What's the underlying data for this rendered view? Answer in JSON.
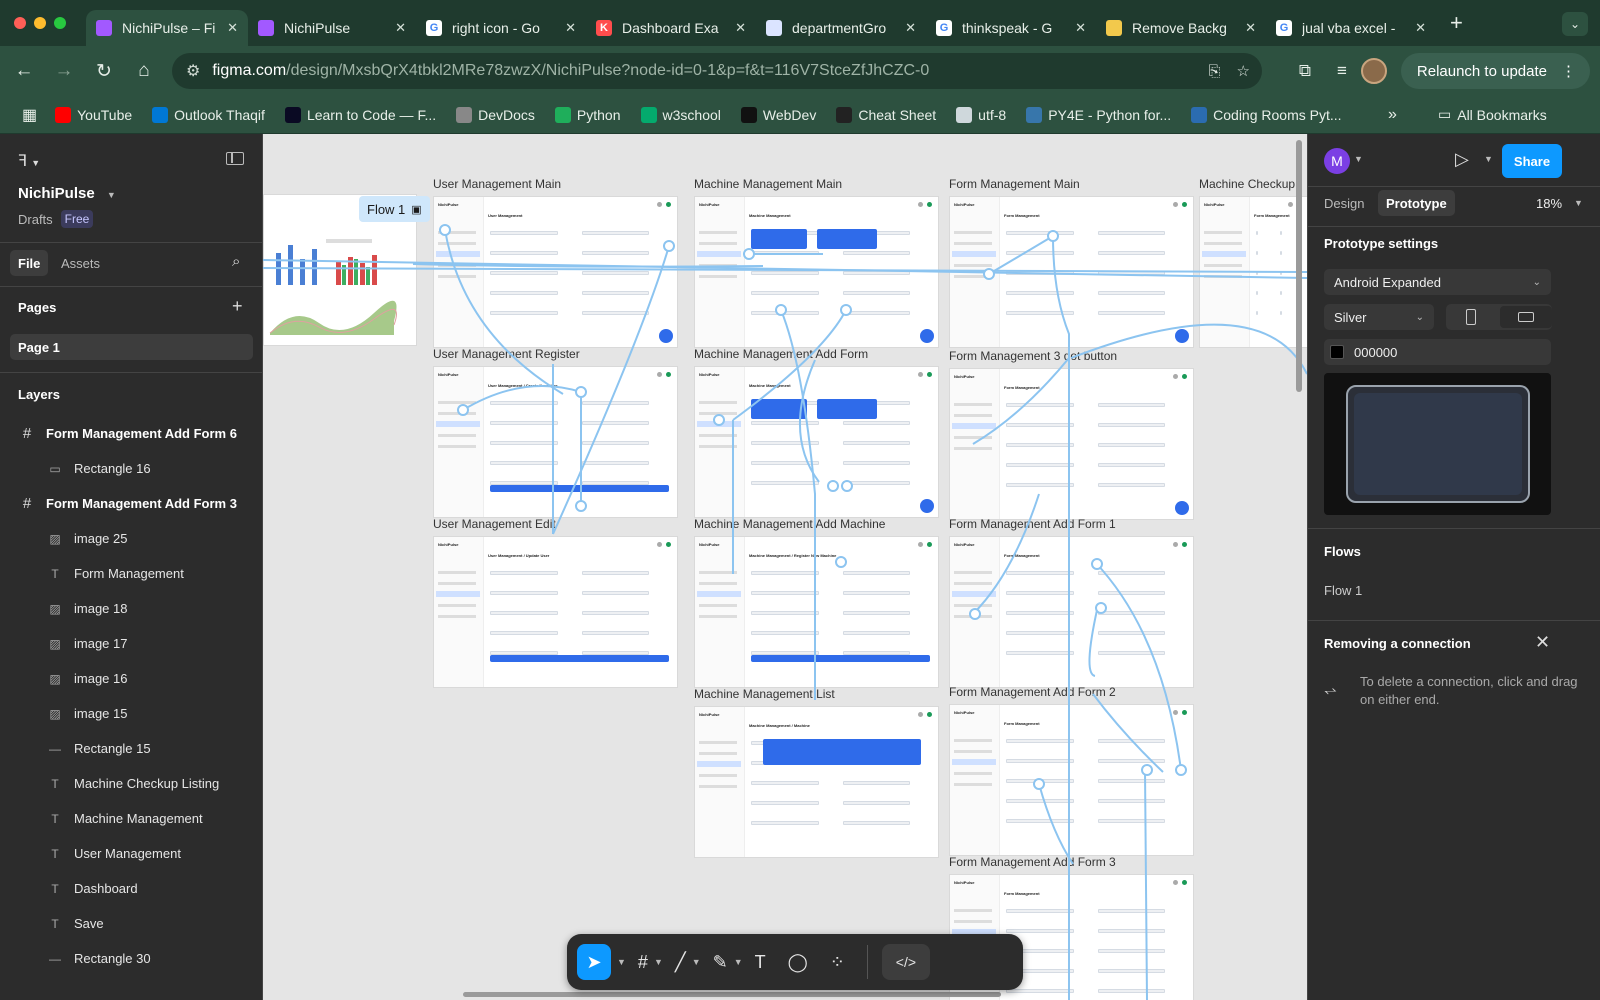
{
  "browser": {
    "tabs": [
      {
        "title": "NichiPulse – Fi",
        "favicon": "figma",
        "active": true
      },
      {
        "title": "NichiPulse",
        "favicon": "figma",
        "active": false
      },
      {
        "title": "right icon - Go",
        "favicon": "google",
        "active": false
      },
      {
        "title": "Dashboard Exa",
        "favicon": "k",
        "active": false
      },
      {
        "title": "departmentGro",
        "favicon": "doc",
        "active": false
      },
      {
        "title": "thinkspeak - G",
        "favicon": "google",
        "active": false
      },
      {
        "title": "Remove Backg",
        "favicon": "removebg",
        "active": false
      },
      {
        "title": "jual vba excel -",
        "favicon": "google",
        "active": false
      }
    ],
    "url_domain": "figma.com",
    "url_path": "/design/MxsbQrX4tbkl2MRe78zwzX/NichiPulse?node-id=0-1&p=f&t=116V7StceZfJhCZC-0",
    "relaunch_label": "Relaunch to update",
    "bookmarks": [
      {
        "label": "YouTube",
        "color": "#ff0000"
      },
      {
        "label": "Outlook Thaqif",
        "color": "#0078d4"
      },
      {
        "label": "Learn to Code — F...",
        "color": "#0a0a23"
      },
      {
        "label": "DevDocs",
        "color": "#888888"
      },
      {
        "label": "Python",
        "color": "#1fae5b"
      },
      {
        "label": "w3school",
        "color": "#04aa6d"
      },
      {
        "label": "WebDev",
        "color": "#111111"
      },
      {
        "label": "Cheat Sheet",
        "color": "#222222"
      },
      {
        "label": "utf-8",
        "color": "#cfd8dc"
      },
      {
        "label": "PY4E - Python for...",
        "color": "#3776ab"
      },
      {
        "label": "Coding Rooms Pyt...",
        "color": "#2b6cb0"
      }
    ],
    "all_bookmarks_label": "All Bookmarks"
  },
  "left_panel": {
    "project_name": "NichiPulse",
    "drafts_label": "Drafts",
    "plan_badge": "Free",
    "file_tab": "File",
    "assets_tab": "Assets",
    "pages_title": "Pages",
    "current_page": "Page 1",
    "layers_title": "Layers",
    "layers": [
      {
        "name": "Form Management Add Form 6",
        "type": "frame",
        "indent": false
      },
      {
        "name": "Rectangle 16",
        "type": "rect",
        "indent": true
      },
      {
        "name": "Form Management Add Form 3",
        "type": "frame",
        "indent": false
      },
      {
        "name": "image 25",
        "type": "image",
        "indent": true
      },
      {
        "name": "Form Management",
        "type": "text",
        "indent": true
      },
      {
        "name": "image 18",
        "type": "image",
        "indent": true
      },
      {
        "name": "image 17",
        "type": "image",
        "indent": true
      },
      {
        "name": "image 16",
        "type": "image",
        "indent": true
      },
      {
        "name": "image 15",
        "type": "image",
        "indent": true
      },
      {
        "name": "Rectangle 15",
        "type": "line",
        "indent": true
      },
      {
        "name": "Machine Checkup Listing",
        "type": "text",
        "indent": true
      },
      {
        "name": "Machine Management",
        "type": "text",
        "indent": true
      },
      {
        "name": "User Management",
        "type": "text",
        "indent": true
      },
      {
        "name": "Dashboard",
        "type": "text",
        "indent": true
      },
      {
        "name": "Save",
        "type": "text",
        "indent": true
      },
      {
        "name": "Rectangle 30",
        "type": "line",
        "indent": true
      }
    ]
  },
  "canvas": {
    "flow_badge": "Flow 1",
    "frames": [
      {
        "label": "User Management Main",
        "header": "User Management"
      },
      {
        "label": "Machine Management Main",
        "header": "Machine Management"
      },
      {
        "label": "Form Management Main",
        "header": "Form Management"
      },
      {
        "label": "Machine Checkup l",
        "header": "Form Management"
      },
      {
        "label": "User Management Register",
        "header": "User Management / Create New User"
      },
      {
        "label": "Machine Management Add Form",
        "header": "Machine Management"
      },
      {
        "label": "Form Management 3 dot button",
        "header": "Form Management"
      },
      {
        "label": "User Management Edit",
        "header": "User Management / Update User"
      },
      {
        "label": "Machine Management Add Machine",
        "header": "Machine Management / Register New Machine"
      },
      {
        "label": "Form Management Add Form 1",
        "header": "Form Management"
      },
      {
        "label": "Machine Management List",
        "header": "Machine Management / Machine"
      },
      {
        "label": "Form Management Add Form 2",
        "header": "Form Management"
      },
      {
        "label": "Form Management Add Form 3",
        "header": "Form Management"
      }
    ],
    "app_name_small": "NichiPulse"
  },
  "right_panel": {
    "avatar_letter": "M",
    "share_label": "Share",
    "design_tab": "Design",
    "prototype_tab": "Prototype",
    "zoom": "18%",
    "prototype_settings_title": "Prototype settings",
    "device": "Android Expanded",
    "device_color": "Silver",
    "background_hex": "000000",
    "flows_title": "Flows",
    "flow_name": "Flow 1",
    "hint_title": "Removing a connection",
    "hint_text": "To delete a connection, click and drag on either end."
  },
  "colors": {
    "figma_blue": "#0d99ff",
    "prototype_line": "#8cc4f0",
    "browser_green": "#2d5140"
  }
}
